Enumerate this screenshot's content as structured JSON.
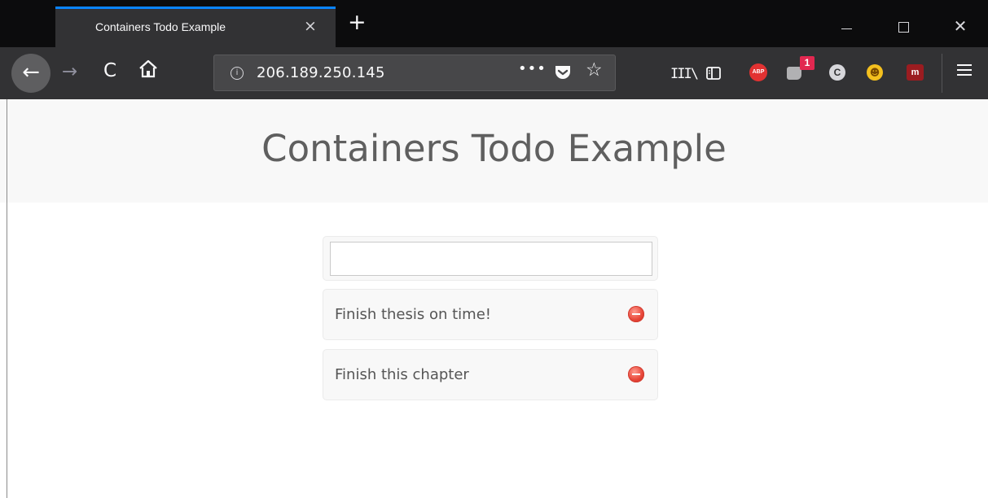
{
  "browser": {
    "tab_title": "Containers Todo Example",
    "tab_close_glyph": "×",
    "new_tab_glyph": "+",
    "window_close_glyph": "✕",
    "url": "206.189.250.145",
    "page_actions_glyph": "•••",
    "star_glyph": "☆",
    "back_glyph": "←",
    "forward_glyph": "→",
    "reload_glyph": "C",
    "info_glyph": "i",
    "library_glyph": "III\\",
    "extensions": {
      "abp_label": "ABP",
      "badge_count": "1",
      "c_label": "C",
      "smiley_glyph": "☻",
      "mendeley_label": "m"
    }
  },
  "page": {
    "title": "Containers Todo Example",
    "input_value": "",
    "todos": [
      {
        "label": "Finish thesis on time!"
      },
      {
        "label": "Finish this chapter"
      }
    ]
  },
  "colors": {
    "tab_accent": "#0a84ff",
    "remove_button": "#e8483a",
    "header_band": "#f8f8f8"
  }
}
